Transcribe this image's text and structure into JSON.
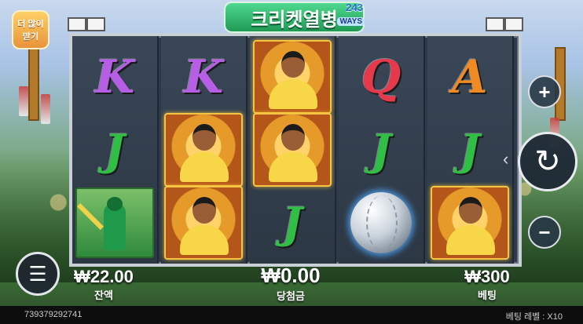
{
  "badge": {
    "line1": "더 많이",
    "line2": "받기"
  },
  "title": {
    "text": "크리켓열병",
    "ways_number": "243",
    "ways_label": "WAYS"
  },
  "reels": [
    [
      "K",
      "J",
      "batsman"
    ],
    [
      "K",
      "player",
      "player"
    ],
    [
      "player",
      "player",
      "J"
    ],
    [
      "Q",
      "J",
      "ball"
    ],
    [
      "A",
      "J",
      "player"
    ]
  ],
  "controls": {
    "plus": "+",
    "minus": "−",
    "spin": "↻",
    "menu": "☰",
    "spin_arrow": "‹"
  },
  "balance": {
    "value": "₩22.00",
    "label": "잔액"
  },
  "win": {
    "value": "₩0.00",
    "label": "당첨금"
  },
  "bet": {
    "value": "₩300",
    "label": "베팅"
  },
  "footer": {
    "game_id": "739379292741",
    "bet_level_label": "베팅 레벨 :",
    "bet_level_value": "X10"
  }
}
